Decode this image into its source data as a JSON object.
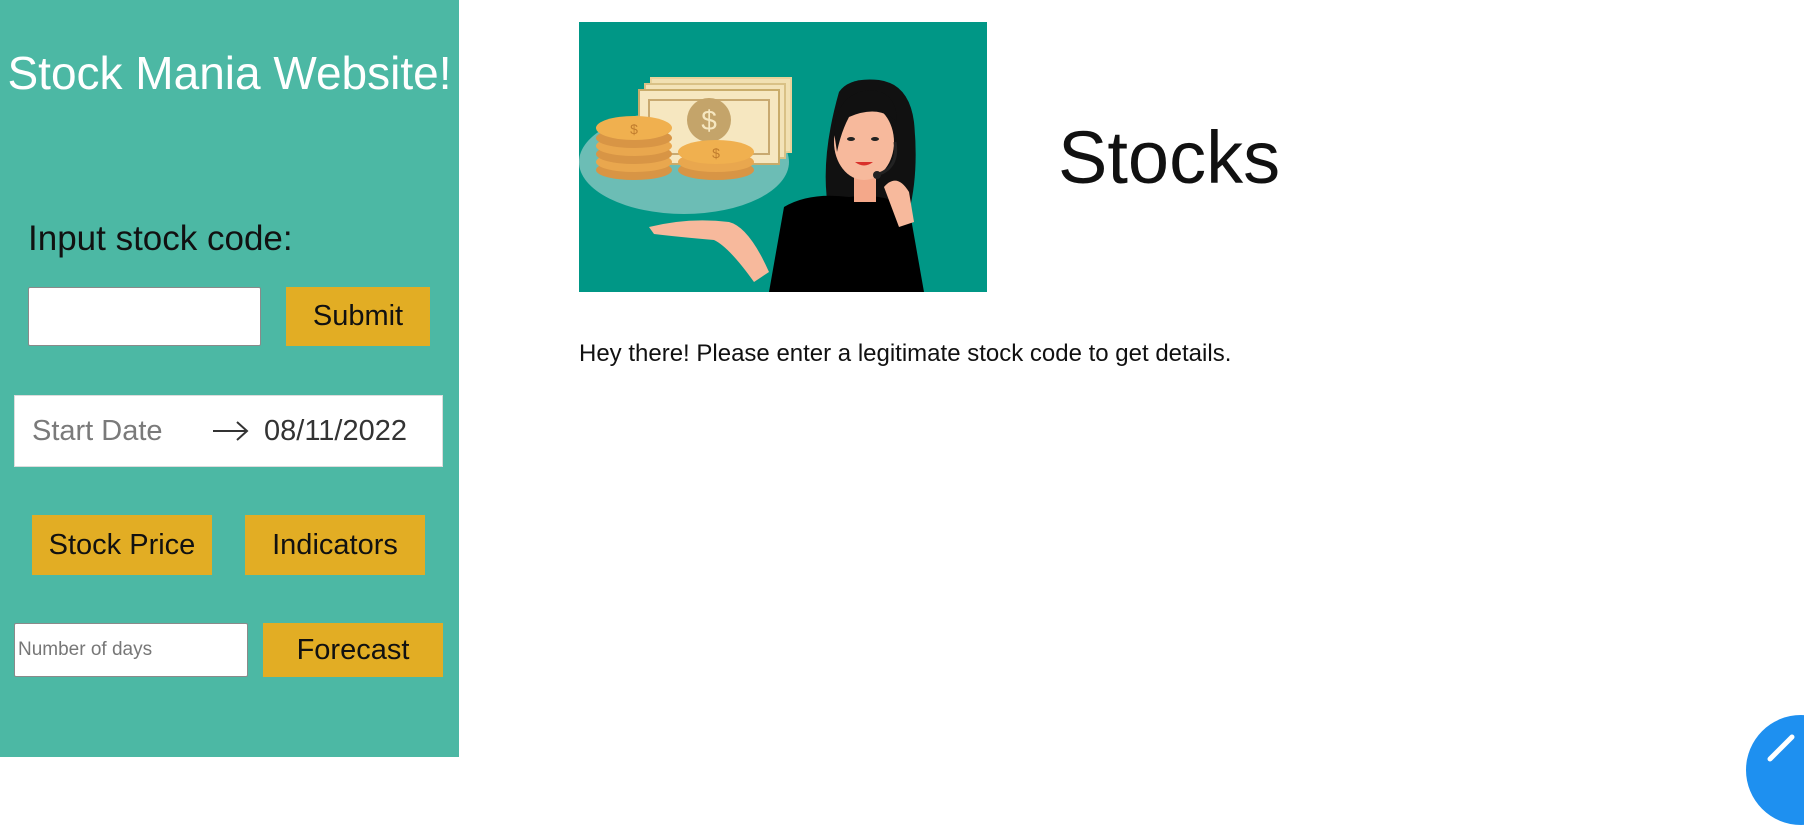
{
  "sidebar": {
    "title": "Stock Mania Website!",
    "stock_label": "Input stock code:",
    "stock_input_value": "",
    "submit_label": "Submit",
    "date_range": {
      "start_placeholder": "Start Date",
      "end_value": "08/11/2022"
    },
    "stock_price_label": "Stock Price",
    "indicators_label": "Indicators",
    "days_placeholder": "Number of days",
    "forecast_label": "Forecast"
  },
  "main": {
    "heading": "Stocks",
    "message": "Hey there! Please enter a legitimate stock code to get details.",
    "hero_image": "customer-service-woman-with-money-illustration"
  },
  "colors": {
    "sidebar_bg": "#4cb8a4",
    "button_bg": "#e2ad24",
    "hero_bg": "#009786",
    "fab_bg": "#1e90f0"
  },
  "icons": {
    "arrow": "arrow-right-icon",
    "fab": "edit-pencil-icon"
  }
}
